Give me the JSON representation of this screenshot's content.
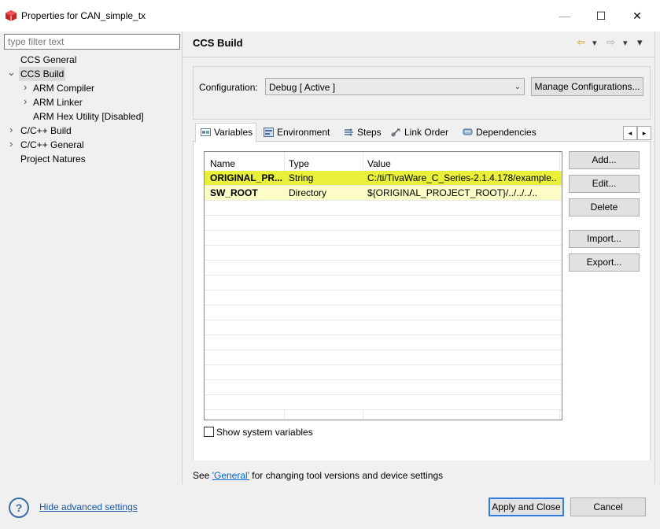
{
  "window": {
    "title": "Properties for CAN_simple_tx",
    "controls": {
      "minimize": "—",
      "maximize": "☐",
      "close": "✕"
    },
    "icon": "package-icon"
  },
  "sidebar": {
    "filter_placeholder": "type filter text",
    "items": [
      {
        "label": "CCS General",
        "expander": ""
      },
      {
        "label": "CCS Build",
        "expander": "⌄",
        "selected": true
      },
      {
        "label": "ARM Compiler",
        "expander": "›"
      },
      {
        "label": "ARM Linker",
        "expander": "›"
      },
      {
        "label": "ARM Hex Utility  [Disabled]",
        "expander": ""
      },
      {
        "label": "C/C++ Build",
        "expander": "›"
      },
      {
        "label": "C/C++ General",
        "expander": "›"
      },
      {
        "label": "Project Natures",
        "expander": ""
      }
    ]
  },
  "main": {
    "title": "CCS Build",
    "nav": {
      "back": "⇦",
      "back_menu": "▾",
      "forward": "⇨",
      "forward_menu": "▾",
      "menu": "▾"
    },
    "configuration": {
      "label": "Configuration:",
      "value": "Debug  [ Active ]",
      "manage_label": "Manage Configurations..."
    },
    "tabs": [
      {
        "label": "Variables",
        "icon": "variables-icon",
        "active": true
      },
      {
        "label": "Environment",
        "icon": "environment-icon"
      },
      {
        "label": "Steps",
        "icon": "steps-icon"
      },
      {
        "label": "Link Order",
        "icon": "link-order-icon"
      },
      {
        "label": "Dependencies",
        "icon": "dependencies-icon"
      }
    ],
    "tab_scroll": {
      "left": "◂",
      "right": "▸"
    },
    "table": {
      "columns": [
        "Name",
        "Type",
        "Value"
      ],
      "rows": [
        {
          "name": "ORIGINAL_PR...",
          "type": "String",
          "value": "C:/ti/TivaWare_C_Series-2.1.4.178/example..."
        },
        {
          "name": "SW_ROOT",
          "type": "Directory",
          "value": "${ORIGINAL_PROJECT_ROOT}/../../../.."
        }
      ]
    },
    "buttons": {
      "add": "Add...",
      "edit": "Edit...",
      "delete": "Delete",
      "import": "Import...",
      "export": "Export..."
    },
    "show_system_variables": {
      "label": "Show system variables",
      "checked": false
    },
    "note": {
      "prefix": "See ",
      "link": "'General'",
      "suffix": " for changing tool versions and device settings"
    }
  },
  "footer": {
    "help": "?",
    "hide_advanced": "Hide advanced settings",
    "apply_close": "Apply and Close",
    "cancel": "Cancel"
  },
  "colors": {
    "highlight_row": "#e8f03a",
    "pale_row": "#fcfcc6",
    "link": "#0066cc",
    "accent": "#2f7de1"
  }
}
